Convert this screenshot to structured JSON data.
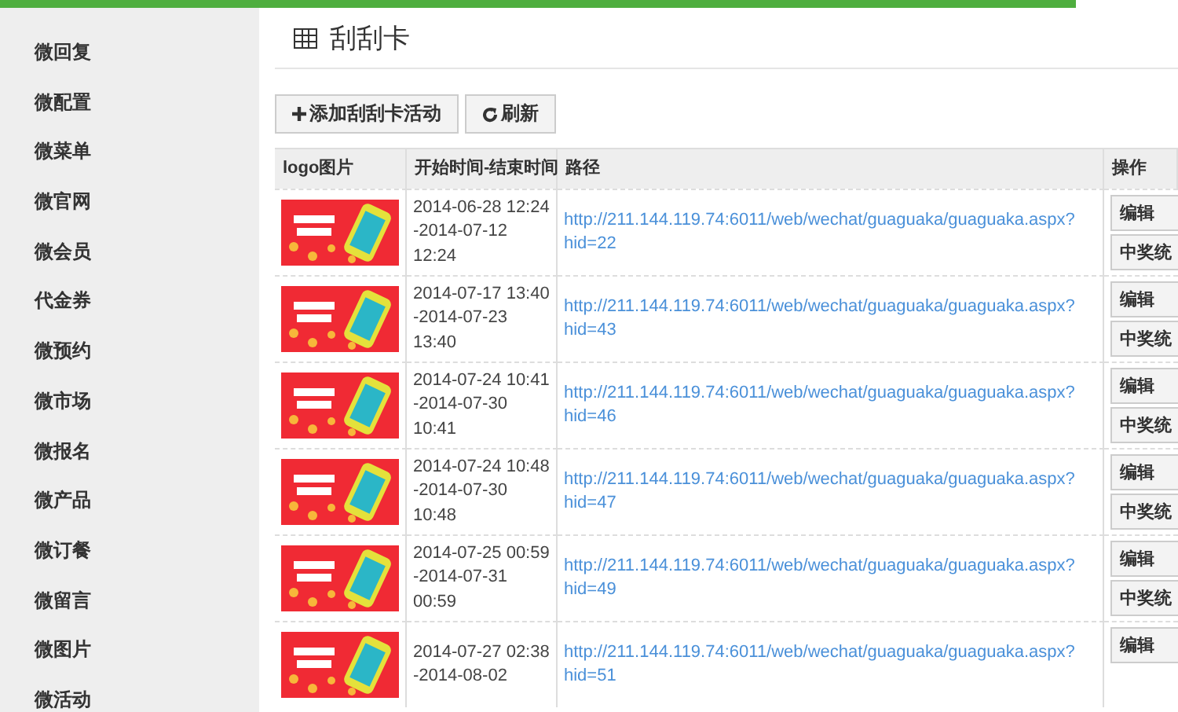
{
  "sidebar": {
    "items": [
      {
        "label": "微回复"
      },
      {
        "label": "微配置"
      },
      {
        "label": "微菜单"
      },
      {
        "label": "微官网"
      },
      {
        "label": "微会员"
      },
      {
        "label": "代金券"
      },
      {
        "label": "微预约"
      },
      {
        "label": "微市场"
      },
      {
        "label": "微报名"
      },
      {
        "label": "微产品"
      },
      {
        "label": "微订餐"
      },
      {
        "label": "微留言"
      },
      {
        "label": "微图片"
      },
      {
        "label": "微活动"
      }
    ]
  },
  "page": {
    "title": "刮刮卡"
  },
  "toolbar": {
    "buttons": [
      {
        "label": "添加刮刮卡活动"
      },
      {
        "label": "刷新"
      }
    ]
  },
  "table": {
    "columns": [
      "logo图片",
      "开始时间-结束时间",
      "路径",
      "操作"
    ],
    "rows": [
      {
        "time": [
          "2014-06-28 12:24",
          "-2014-07-12",
          "12:24"
        ],
        "url": "http://211.144.119.74:6011/web/wechat/guaguaka/guaguaka.aspx?hid=22",
        "actions": [
          "编辑",
          "中奖统"
        ]
      },
      {
        "time": [
          "2014-07-17 13:40",
          "-2014-07-23",
          "13:40"
        ],
        "url": "http://211.144.119.74:6011/web/wechat/guaguaka/guaguaka.aspx?hid=43",
        "actions": [
          "编辑",
          "中奖统"
        ]
      },
      {
        "time": [
          "2014-07-24 10:41",
          "-2014-07-30",
          "10:41"
        ],
        "url": "http://211.144.119.74:6011/web/wechat/guaguaka/guaguaka.aspx?hid=46",
        "actions": [
          "编辑",
          "中奖统"
        ]
      },
      {
        "time": [
          "2014-07-24 10:48",
          "-2014-07-30",
          "10:48"
        ],
        "url": "http://211.144.119.74:6011/web/wechat/guaguaka/guaguaka.aspx?hid=47",
        "actions": [
          "编辑",
          "中奖统"
        ]
      },
      {
        "time": [
          "2014-07-25 00:59",
          "-2014-07-31",
          "00:59"
        ],
        "url": "http://211.144.119.74:6011/web/wechat/guaguaka/guaguaka.aspx?hid=49",
        "actions": [
          "编辑",
          "中奖统"
        ]
      },
      {
        "time": [
          "2014-07-27 02:38",
          "-2014-08-02"
        ],
        "url": "http://211.144.119.74:6011/web/wechat/guaguaka/guaguaka.aspx?hid=51",
        "actions": [
          "编辑"
        ]
      }
    ]
  }
}
